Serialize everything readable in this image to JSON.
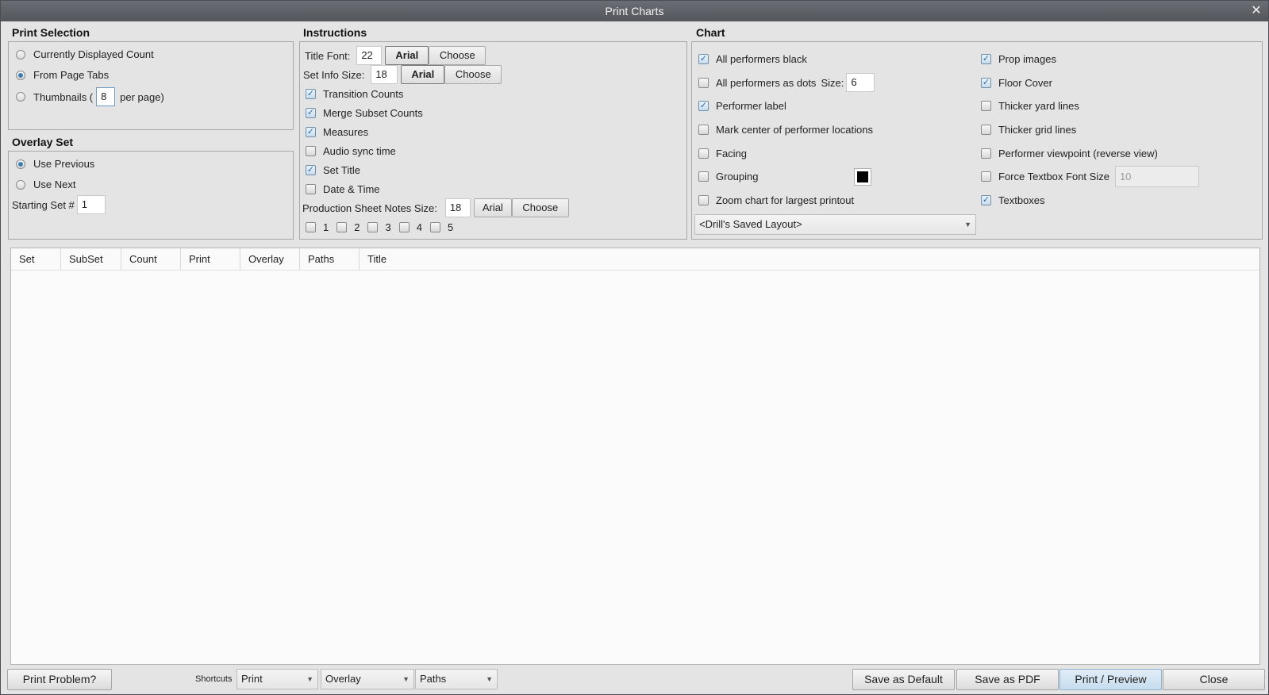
{
  "window": {
    "title": "Print Charts"
  },
  "print_selection": {
    "title": "Print Selection",
    "options": [
      {
        "label": "Currently Displayed Count",
        "selected": false
      },
      {
        "label": "From Page Tabs",
        "selected": true
      },
      {
        "label": "Thumbnails (",
        "selected": false
      }
    ],
    "thumbnails_value": "8",
    "thumbnails_suffix": "per page)"
  },
  "overlay_set": {
    "title": "Overlay Set",
    "options": [
      {
        "label": "Use Previous",
        "selected": true
      },
      {
        "label": "Use Next",
        "selected": false
      }
    ],
    "starting_label": "Starting Set #",
    "starting_value": "1"
  },
  "instructions": {
    "title": "Instructions",
    "title_font_label": "Title Font:",
    "title_font_size": "22",
    "title_font_name": "Arial",
    "choose_label": "Choose",
    "set_info_label": "Set Info Size:",
    "set_info_size": "18",
    "set_info_font": "Arial",
    "checkboxes": [
      {
        "label": "Transition Counts",
        "checked": true
      },
      {
        "label": "Merge Subset Counts",
        "checked": true
      },
      {
        "label": "Measures",
        "checked": true
      },
      {
        "label": "Audio sync time",
        "checked": false
      },
      {
        "label": "Set Title",
        "checked": true
      },
      {
        "label": "Date & Time",
        "checked": false
      }
    ],
    "notes_label": "Production Sheet Notes Size:",
    "notes_size": "18",
    "notes_font": "Arial",
    "pages": [
      "1",
      "2",
      "3",
      "4",
      "5"
    ]
  },
  "chart": {
    "title": "Chart",
    "left": [
      {
        "label": "All performers black",
        "checked": true
      },
      {
        "label": "All performers as dots",
        "checked": false
      },
      {
        "label": "Performer label",
        "checked": true
      },
      {
        "label": "Mark center of performer locations",
        "checked": false
      },
      {
        "label": "Facing",
        "checked": false
      },
      {
        "label": "Grouping",
        "checked": false
      },
      {
        "label": "Zoom chart for largest printout",
        "checked": false
      }
    ],
    "dots_size_label": "Size:",
    "dots_size_value": "6",
    "right": [
      {
        "label": "Prop images",
        "checked": true
      },
      {
        "label": "Floor Cover",
        "checked": true
      },
      {
        "label": "Thicker yard lines",
        "checked": false
      },
      {
        "label": "Thicker grid lines",
        "checked": false
      },
      {
        "label": "Performer viewpoint (reverse view)",
        "checked": false
      },
      {
        "label": "Force Textbox Font Size",
        "checked": false
      },
      {
        "label": "Textboxes",
        "checked": true
      }
    ],
    "textbox_font_size": "10",
    "layout_select": "<Drill's Saved Layout>",
    "grouping_color": "#000000"
  },
  "table": {
    "columns": [
      "Set",
      "SubSet",
      "Count",
      "Print",
      "Overlay",
      "Paths",
      "Title"
    ]
  },
  "footer": {
    "print_problem": "Print Problem?",
    "shortcuts_label": "Shortcuts",
    "shortcut_1": "Print",
    "shortcut_2": "Overlay",
    "shortcut_3": "Paths",
    "save_default": "Save as Default",
    "save_pdf": "Save as PDF",
    "print_preview": "Print / Preview",
    "close": "Close"
  }
}
